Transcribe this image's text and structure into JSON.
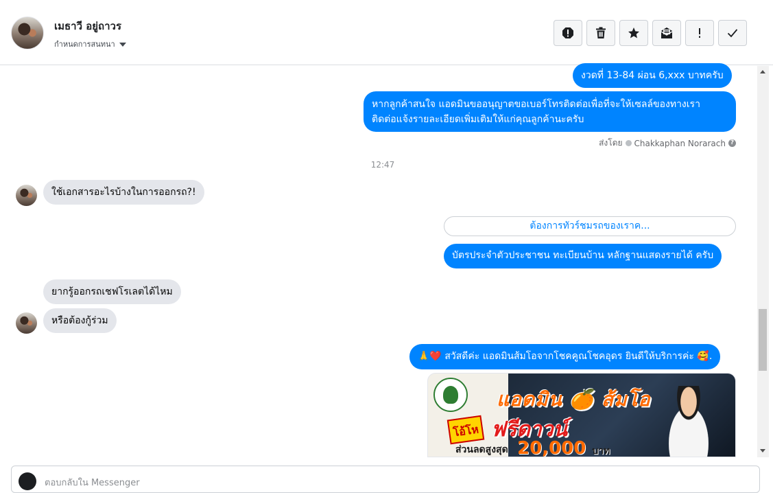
{
  "header": {
    "contact_name": "เมธาวี อยู่ถาวร",
    "assign_label": "กำหนดการสนทนา",
    "actions": [
      {
        "name": "report-icon"
      },
      {
        "name": "trash-icon"
      },
      {
        "name": "star-icon"
      },
      {
        "name": "mark-unread-icon"
      },
      {
        "name": "exclamation-icon"
      },
      {
        "name": "check-icon"
      }
    ]
  },
  "thread": {
    "messages_out_top": [
      {
        "text": "งวดที่ 13-84 ผ่อน 6,xxx บาทครับ"
      },
      {
        "line1": "หากลูกค้าสนใจ แอดมินขออนุญาตขอเบอร์โทรติดต่อเพื่อที่จะให้เซลล์ของทางเรา",
        "line2": "ติดต่อแจ้งรายละเอียดเพิ่มเติมให้แก่คุณลูกค้านะครับ"
      }
    ],
    "sent_by_prefix": "ส่งโดย",
    "sent_by_name": "Chakkaphan Norarach",
    "timestamp": "12:47",
    "incoming_1": "ใช้เอกสารอะไรบ้างในการออกรถ?!",
    "quick_reply": "ต้องการทัวร์ชมรถของเราค...",
    "outgoing_docs": "บัตรประจำตัวประชาชน ทะเบียนบ้าน หลักฐานแสดงรายได้ ครับ",
    "incoming_2": "ยากรู้ออกรถเชฟโรเลตได้ไหม",
    "incoming_3": "หรือต้องกู้ร่วม",
    "greeting": "🙏❤️ สวัสดีค่ะ แอดมินส้มโอจากโชคคูณโชคอุดร ยินดีให้บริการค่ะ 🥰.",
    "promo": {
      "title": "แอดมิน 🍊 ส้มโอ",
      "burst": "โอ้โห",
      "free": "ฟรีดาวน์",
      "discount_label": "ส่วนลดสูงสุด",
      "amount": "20,000",
      "unit": "บาท"
    }
  },
  "composer": {
    "placeholder": "ตอบกลับใน Messenger"
  },
  "colors": {
    "outgoing_bubble": "#0084ff",
    "incoming_bubble": "#e4e6eb"
  }
}
